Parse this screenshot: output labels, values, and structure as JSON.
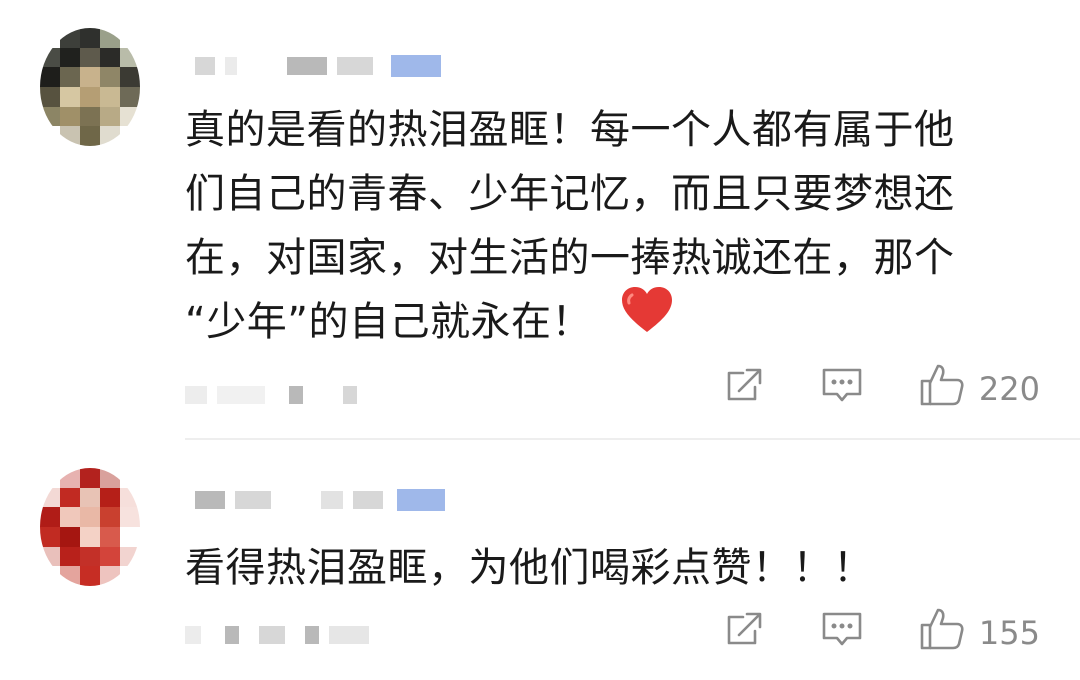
{
  "comments": [
    {
      "text": "真的是看的热泪盈眶！每一个人都有属于他们自己的青春、少年记忆，而且只要梦想还在，对国家，对生活的一捧热诚还在，那个“少年”的自己就永在！",
      "lines": [
        "真的是看的热泪盈眶！每一个人都有属于他",
        "们自己的青春、少年记忆，而且只要梦想还",
        "在，对国家，对生活的一捧热诚还在，那个",
        "“少年”的自己就永在！"
      ],
      "emoji": "heart-emoji",
      "like_count": "220",
      "accent_color": "#e53935"
    },
    {
      "text": "看得热泪盈眶，为他们喝彩点赞！！！",
      "lines": [
        "看得热泪盈眶，为他们喝彩点赞！！！"
      ],
      "like_count": "155"
    }
  ],
  "icons": {
    "share": "share-icon",
    "reply": "comment-icon",
    "like": "thumbs-up-icon"
  },
  "colors": {
    "text": "#1a1a1a",
    "meta": "#8a8a8a",
    "heart": "#e53935",
    "badge": "#9fb8ea"
  }
}
